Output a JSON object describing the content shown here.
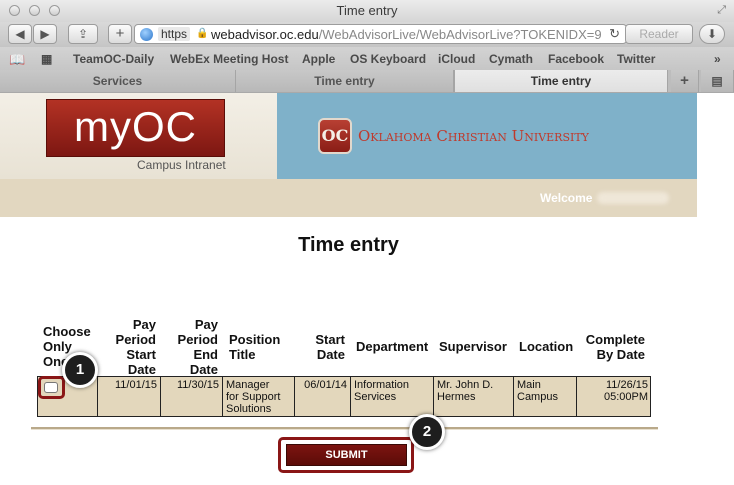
{
  "window": {
    "title": "Time entry"
  },
  "toolbar": {
    "back_icon": "◀",
    "forward_icon": "▶",
    "share_icon": "⇪",
    "new_tab_icon": "+",
    "https_label": "https",
    "url_host": "webadvisor.oc.edu",
    "url_path": "/WebAdvisorLive/WebAdvisorLive?TOKENIDX=9",
    "reader_label": "Reader"
  },
  "bookmarks": [
    "TeamOC-Daily",
    "WebEx Meeting Host",
    "Apple",
    "OS Keyboard",
    "iCloud",
    "Cymath",
    "Facebook",
    "Twitter"
  ],
  "tabs": [
    {
      "label": "Services"
    },
    {
      "label": "Time entry"
    },
    {
      "label": "Time entry"
    }
  ],
  "header": {
    "logo_text": "myOC",
    "logo_subtitle": "Campus Intranet",
    "univ_mark": "OC",
    "univ_name": "Oklahoma Christian University",
    "welcome": "Welcome"
  },
  "page": {
    "heading": "Time entry"
  },
  "table": {
    "headers": {
      "choose": [
        "Choose",
        "Only",
        "One"
      ],
      "pay_start": [
        "Pay",
        "Period",
        "Start",
        "Date"
      ],
      "pay_end": [
        "Pay",
        "Period",
        "End",
        "Date"
      ],
      "position": [
        "Position",
        "Title"
      ],
      "start_date": [
        "Start",
        "Date"
      ],
      "department": "Department",
      "supervisor": "Supervisor",
      "location": "Location",
      "complete": [
        "Complete",
        "By Date"
      ]
    },
    "row": {
      "pay_start": "11/01/15",
      "pay_end": "11/30/15",
      "position": [
        "Manager",
        "for Support",
        "Solutions"
      ],
      "start_date": "06/01/14",
      "department": [
        "Information",
        "Services"
      ],
      "supervisor": [
        "Mr. John D.",
        "Hermes"
      ],
      "location": [
        "Main",
        "Campus"
      ],
      "complete": [
        "11/26/15",
        "05:00PM"
      ]
    }
  },
  "submit_label": "SUBMIT",
  "callouts": [
    "1",
    "2"
  ]
}
